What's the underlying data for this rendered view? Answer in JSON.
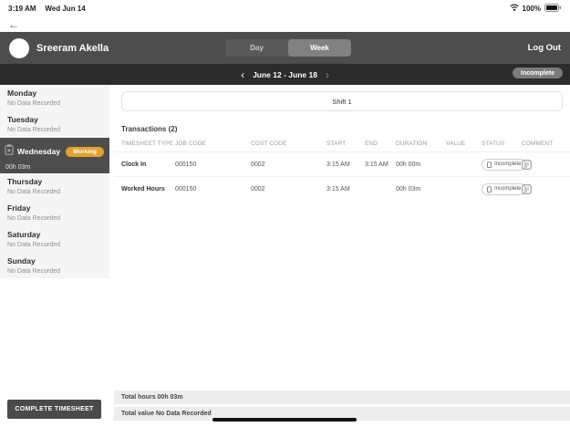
{
  "status_bar": {
    "time": "3:19 AM",
    "date": "Wed Jun 14",
    "battery_percent": "100%"
  },
  "nav": {
    "back_icon": "left-arrow"
  },
  "header": {
    "user_name": "Sreeram Akella",
    "view_toggle": {
      "day_label": "Day",
      "week_label": "Week",
      "selected": "Week"
    },
    "logout_label": "Log Out"
  },
  "date_bar": {
    "prev_icon": "chevron-left",
    "range": "June 12 - June 18",
    "next_icon": "chevron-right",
    "status_badge": "Incomplete"
  },
  "sidebar": {
    "days": [
      {
        "name": "Monday",
        "status": "No Data Recorded",
        "active": false
      },
      {
        "name": "Tuesday",
        "status": "No Data Recorded",
        "active": false
      },
      {
        "name": "Wednesday",
        "badge": "Working",
        "hours": "00h 03m",
        "active": true
      },
      {
        "name": "Thursday",
        "status": "No Data Recorded",
        "active": false
      },
      {
        "name": "Friday",
        "status": "No Data Recorded",
        "active": false
      },
      {
        "name": "Saturday",
        "status": "No Data Recorded",
        "active": false
      },
      {
        "name": "Sunday",
        "status": "No Data Recorded",
        "active": false
      }
    ]
  },
  "main": {
    "shift_label": "Shift 1",
    "transactions_title": "Transactions (2)",
    "table": {
      "columns": [
        "TIMESHEET TYPE",
        "JOB CODE",
        "COST CODE",
        "START",
        "END",
        "DURATION",
        "VALUE",
        "STATUS",
        "COMMENT"
      ],
      "rows": [
        {
          "timesheet_type": "Clock In",
          "job_code": "000150",
          "cost_code": "0002",
          "start": "3:15 AM",
          "end": "3:15 AM",
          "duration": "00h 00m",
          "value": "",
          "status": "Incomplete"
        },
        {
          "timesheet_type": "Worked Hours",
          "job_code": "000150",
          "cost_code": "0002",
          "start": "3:15 AM",
          "end": "",
          "duration": "00h 03m",
          "value": "",
          "status": "Incomplete"
        }
      ]
    },
    "totals": {
      "hours": "Total hours 00h 03m",
      "value": "Total value No Data Recorded"
    }
  },
  "footer": {
    "complete_button": "COMPLETE TIMESHEET"
  },
  "colors": {
    "header_bg": "#4d4d4d",
    "date_bar_bg": "#2b2b2b",
    "working_badge": "#E4A02C",
    "sidebar_bg": "#f5f5f5",
    "totals_bg": "#ededed"
  }
}
